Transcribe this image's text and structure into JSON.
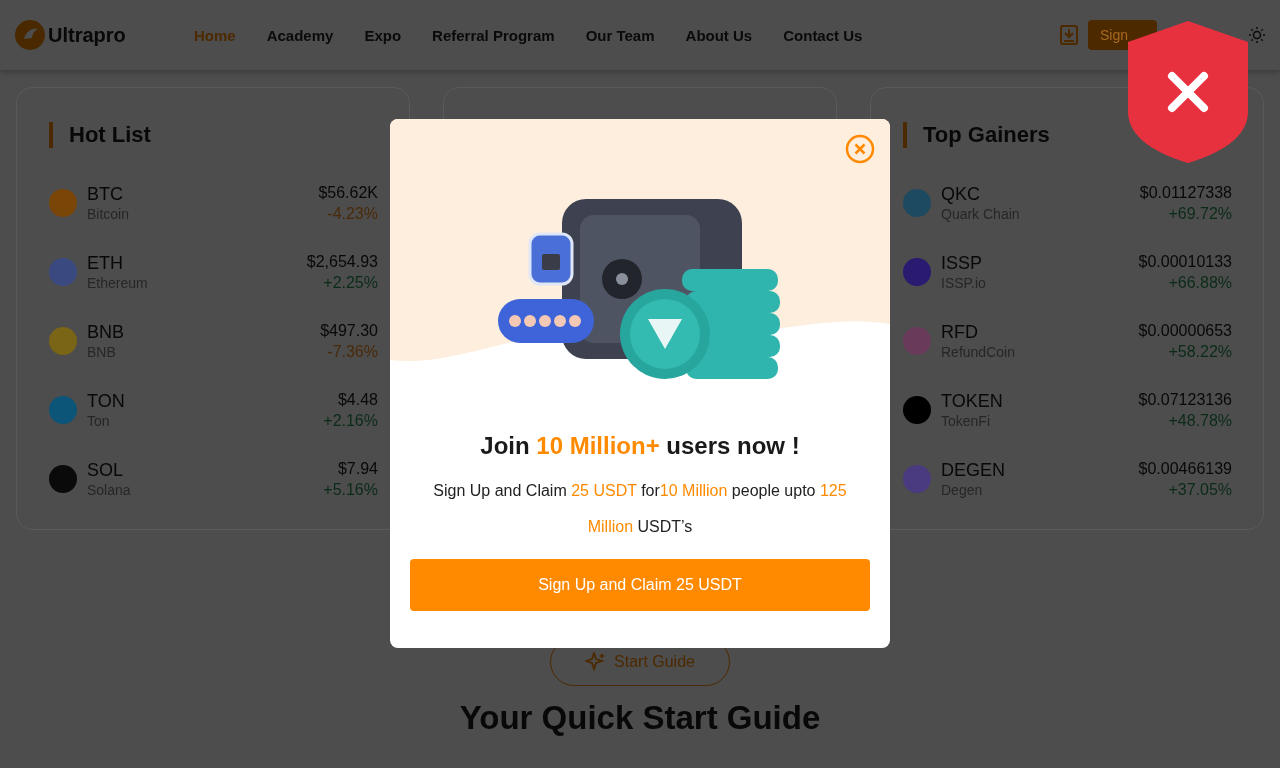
{
  "header": {
    "logo": "Ultrapro",
    "nav": [
      {
        "label": "Home",
        "selected": true
      },
      {
        "label": "Academy",
        "selected": false
      },
      {
        "label": "Expo",
        "selected": false
      },
      {
        "label": "Referral Program",
        "selected": false
      },
      {
        "label": "Our Team",
        "selected": false
      },
      {
        "label": "About Us",
        "selected": false
      },
      {
        "label": "Contact Us",
        "selected": false
      }
    ],
    "signup_button": "Sign"
  },
  "cards": [
    {
      "title": "Hot List",
      "coins": [
        {
          "symbol": "BTC",
          "name": "Bitcoin",
          "price": "$56.62K",
          "change": "-4.23%",
          "negative": true,
          "color": "#7a4608"
        },
        {
          "symbol": "ETH",
          "name": "Ethereum",
          "price": "$2,654.93",
          "change": "+2.25%",
          "negative": false,
          "color": "#3a4a80"
        },
        {
          "symbol": "BNB",
          "name": "BNB",
          "price": "$497.30",
          "change": "-7.36%",
          "negative": true,
          "color": "#7a6416"
        },
        {
          "symbol": "TON",
          "name": "Ton",
          "price": "$4.48",
          "change": "+2.16%",
          "negative": false,
          "color": "#0c5478"
        },
        {
          "symbol": "SOL",
          "name": "Solana",
          "price": "$7.94",
          "change": "+5.16%",
          "negative": false,
          "color": "#0a0a0a"
        }
      ]
    },
    {
      "title": "Top Gainers",
      "coins": [
        {
          "symbol": "QKC",
          "name": "Quark Chain",
          "price": "$0.01127338",
          "change": "+69.72%",
          "negative": false,
          "color": "#1d4a60"
        },
        {
          "symbol": "ISSP",
          "name": "ISSP.io",
          "price": "$0.00010133",
          "change": "+66.88%",
          "negative": false,
          "color": "#2a1a70"
        },
        {
          "symbol": "RFD",
          "name": "RefundCoin",
          "price": "$0.00000653",
          "change": "+58.22%",
          "negative": false,
          "color": "#6a3a5a"
        },
        {
          "symbol": "TOKEN",
          "name": "TokenFi",
          "price": "$0.07123136",
          "change": "+48.78%",
          "negative": false,
          "color": "#000000"
        },
        {
          "symbol": "DEGEN",
          "name": "Degen",
          "price": "$0.00466139",
          "change": "+37.05%",
          "negative": false,
          "color": "#4a3a80"
        }
      ]
    }
  ],
  "guide": {
    "button": "Start Guide",
    "heading": "Your Quick Start Guide"
  },
  "modal": {
    "headline": "Join **10 Million+** users now !",
    "text": "Sign Up and Claim **25 USDT** for**10 Million** people upto **125 Million** USDT’s",
    "button": "Sign Up and Claim 25 USDT"
  }
}
